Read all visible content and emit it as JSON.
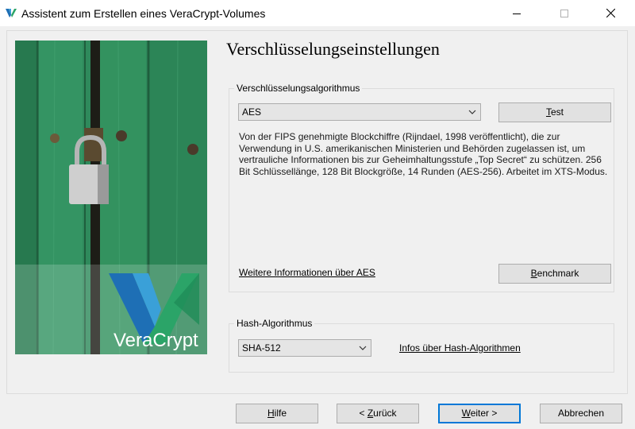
{
  "window": {
    "title": "Assistent zum Erstellen eines VeraCrypt-Volumes",
    "icon": "veracrypt-logo-icon",
    "controls": [
      "minimize-icon",
      "maximize-icon",
      "close-icon"
    ]
  },
  "sidebar_image": {
    "description_icon": "padlock-on-green-door",
    "brand_text": "VeraCrypt"
  },
  "page": {
    "heading": "Verschlüsselungseinstellungen"
  },
  "encryption_group": {
    "label": "Verschlüsselungsalgorithmus",
    "algorithm_value": "AES",
    "test_button_prefix": "",
    "test_button_accel": "T",
    "test_button_rest": "est",
    "description": "Von der FIPS genehmigte Blockchiffre (Rijndael, 1998 veröffentlicht), die zur Verwendung in U.S. amerikanischen Ministerien und Behörden zugelassen ist, um vertrauliche Informationen bis zur Geheimhaltungsstufe „Top Secret“ zu schützen. 256 Bit Schlüssellänge, 128 Bit Blockgröße, 14 Runden (AES-256). Arbeitet im XTS-Modus.",
    "more_info_link": "Weitere Informationen über AES",
    "benchmark_accel": "B",
    "benchmark_rest": "enchmark"
  },
  "hash_group": {
    "label": "Hash-Algorithmus",
    "hash_value": "SHA-512",
    "info_link": "Infos über Hash-Algorithmen"
  },
  "footer": {
    "help_accel": "H",
    "help_rest": "ilfe",
    "back_prefix": "< ",
    "back_accel": "Z",
    "back_rest": "urück",
    "next_accel": "W",
    "next_rest": "eiter >",
    "cancel_label": "Abbrechen"
  },
  "colors": {
    "accent": "#0078d7",
    "door_green": "#2f8a5c",
    "logo_blue": "#1e6fb5",
    "logo_green": "#2ba468"
  }
}
